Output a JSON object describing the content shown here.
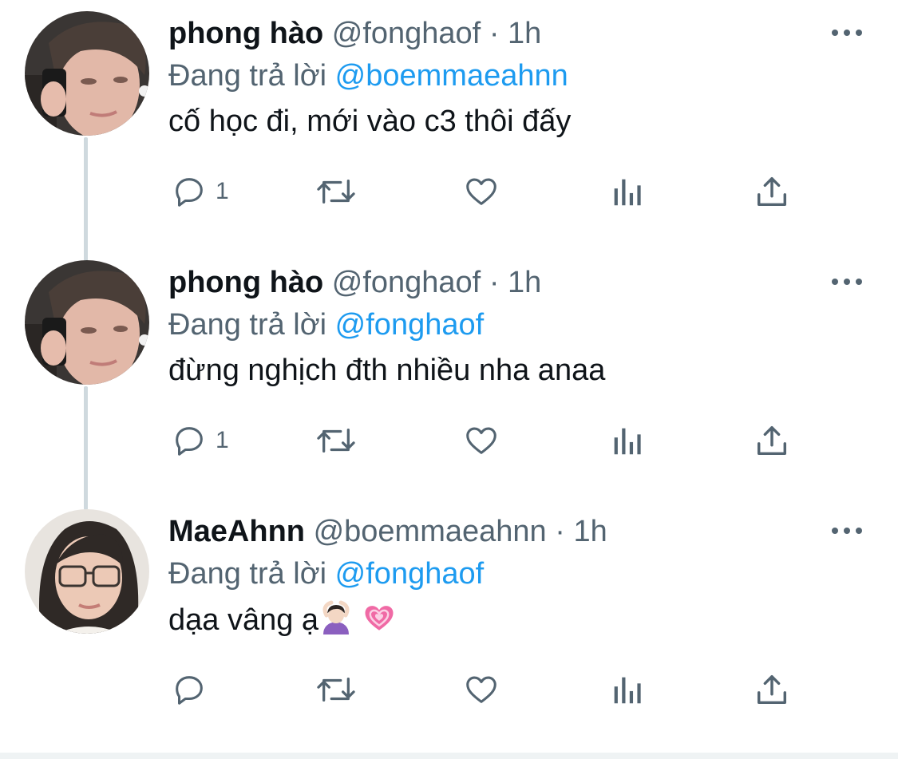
{
  "colors": {
    "text": "#0f1419",
    "secondary": "#536471",
    "link": "#1d9bf0",
    "thread_line": "#cfd9de"
  },
  "tweets": [
    {
      "display_name": "phong hào",
      "handle": "@fonghaof",
      "separator": "·",
      "time": "1h",
      "reply_prefix": "Đang trả lời",
      "reply_to": "@boemmaeahnn",
      "text": "cố học đi, mới vào c3 thôi đấy",
      "reply_count": "1",
      "avatar": "male-avatar-photo"
    },
    {
      "display_name": "phong hào",
      "handle": "@fonghaof",
      "separator": "·",
      "time": "1h",
      "reply_prefix": "Đang trả lời",
      "reply_to": "@fonghaof",
      "text": "đừng nghịch đth nhiều nha anaa",
      "reply_count": "1",
      "avatar": "male-avatar-photo"
    },
    {
      "display_name": "MaeAhnn",
      "handle": "@boemmaeahnn",
      "separator": "·",
      "time": "1h",
      "reply_prefix": "Đang trả lời",
      "reply_to": "@fonghaof",
      "text": "dạa vâng ạ",
      "text_emojis": [
        "woman-heart-hands-emoji",
        "growing-heart-emoji"
      ],
      "reply_count": "",
      "avatar": "female-avatar-photo"
    }
  ],
  "action_icons": [
    "reply-icon",
    "retweet-icon",
    "like-icon",
    "analytics-icon",
    "share-icon"
  ],
  "more_icon": "more-options-icon"
}
